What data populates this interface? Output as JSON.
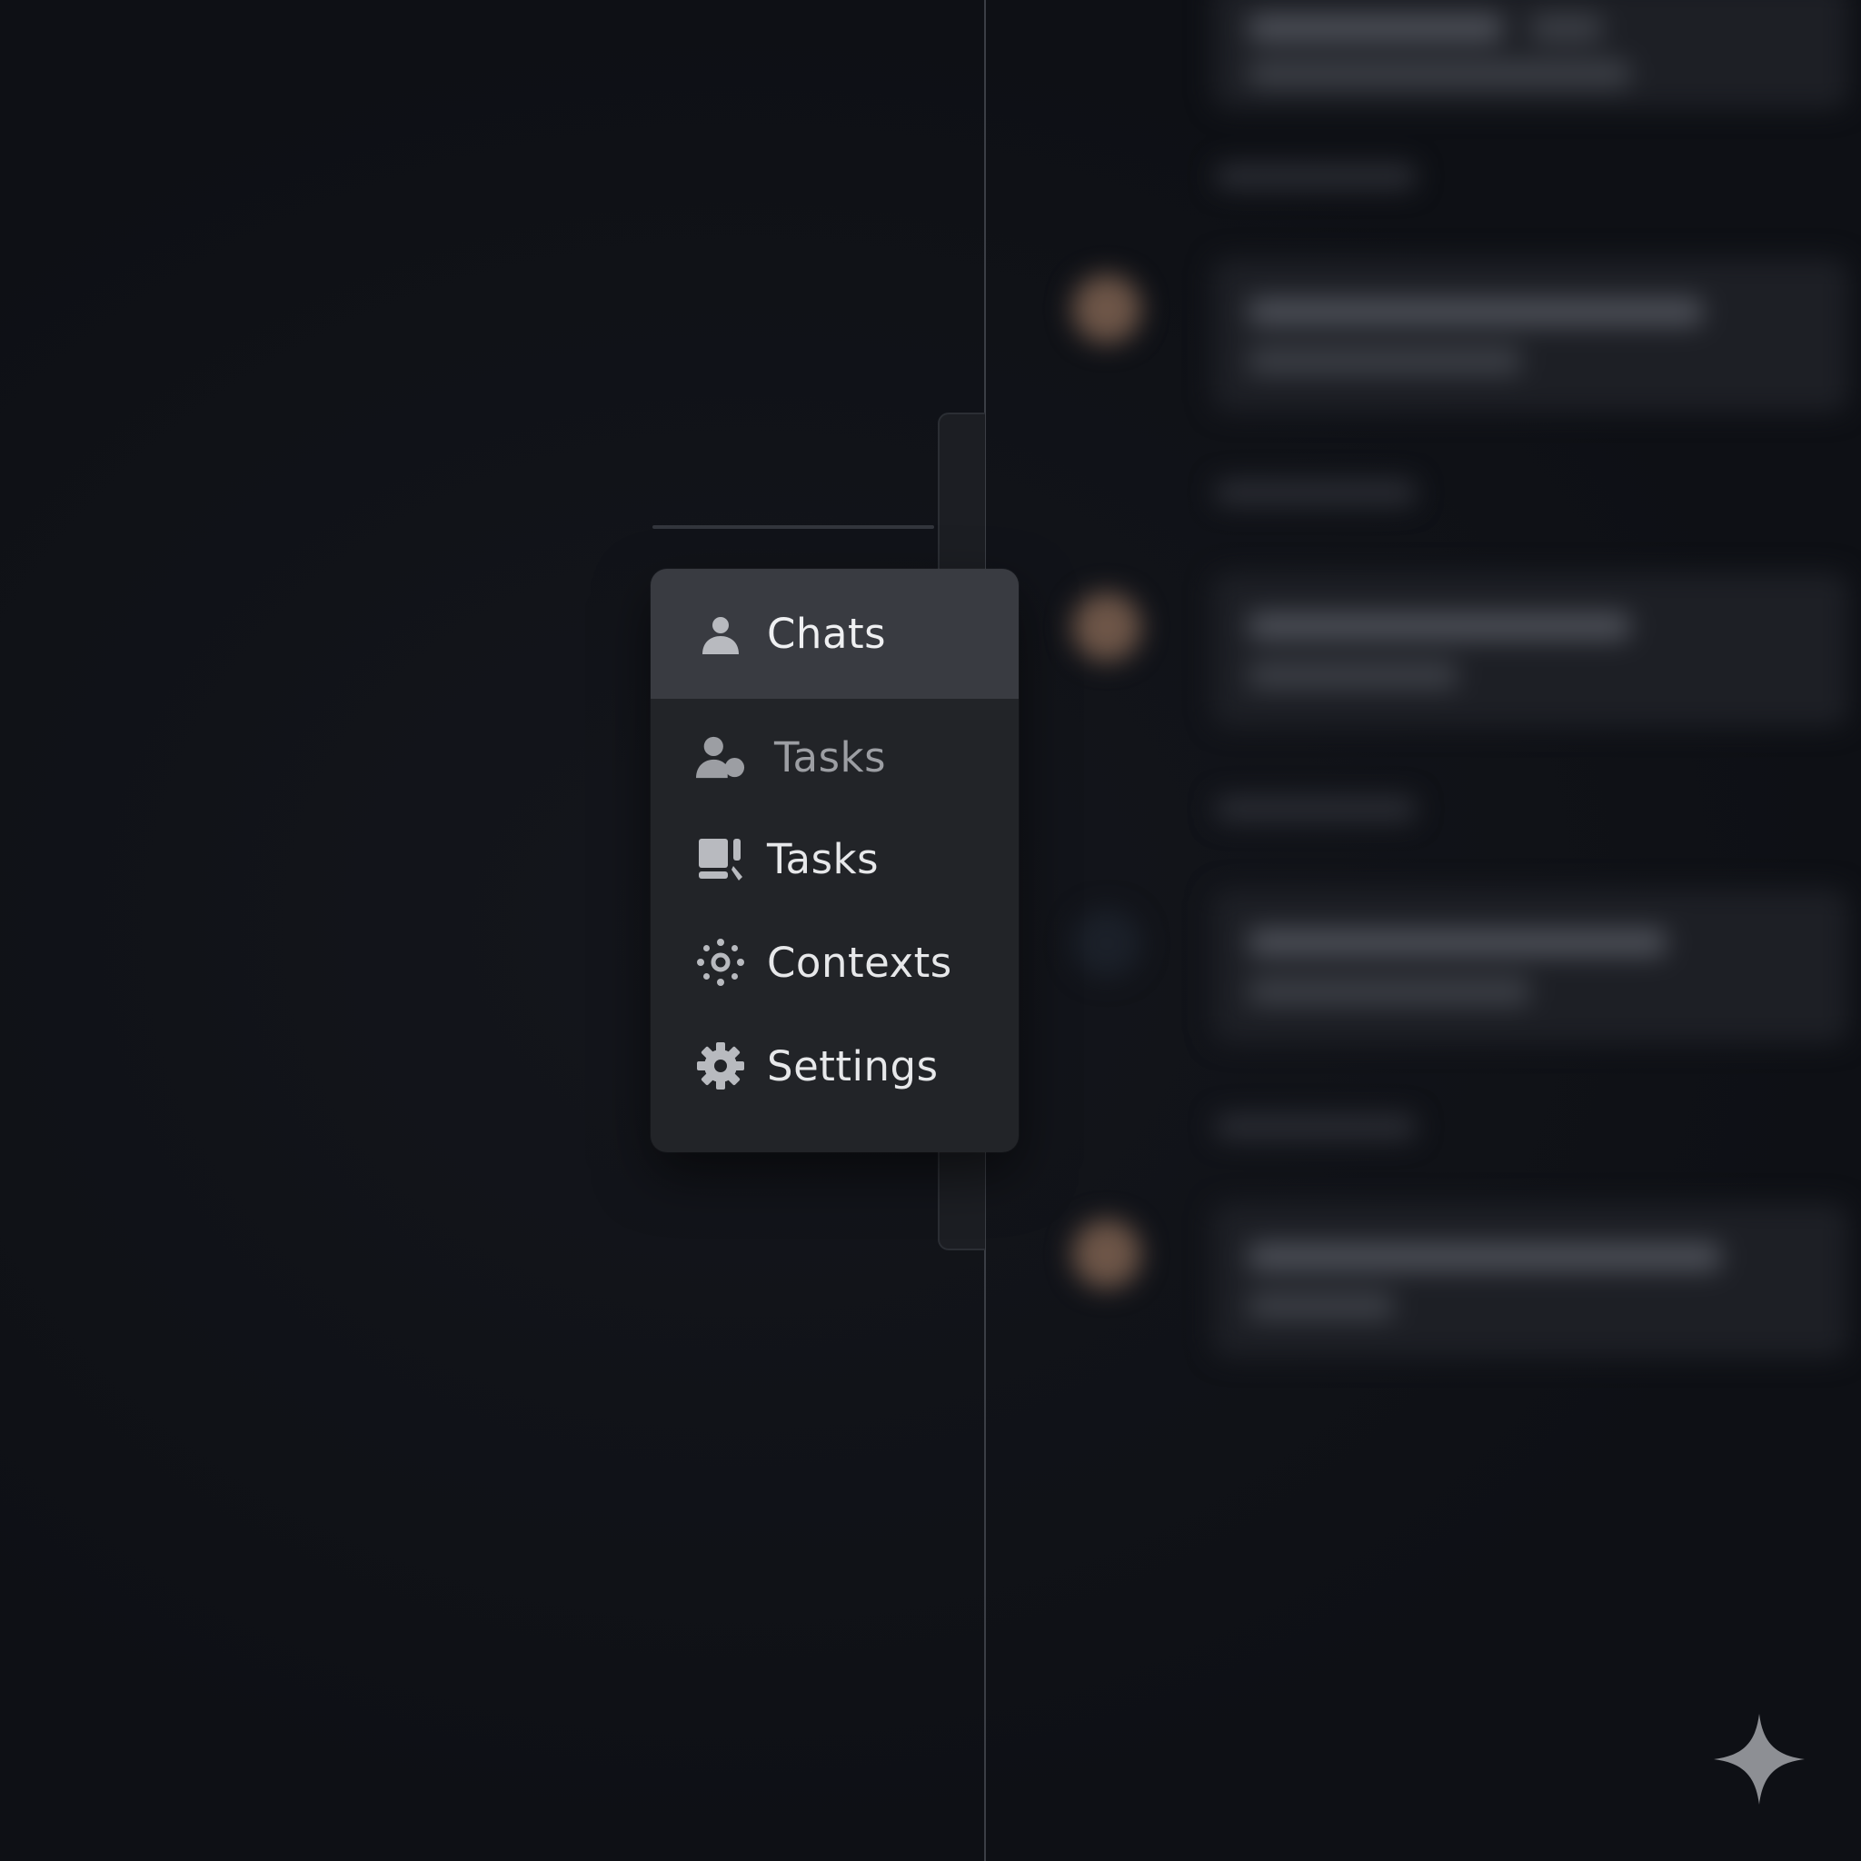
{
  "menu": {
    "items": [
      {
        "label": "Chats",
        "icon": "person-icon",
        "state": "selected"
      },
      {
        "label": "Tasks",
        "icon": "person-group-icon",
        "state": "muted"
      },
      {
        "label": "Tasks",
        "icon": "tasks-board-icon",
        "state": "normal"
      },
      {
        "label": "Contexts",
        "icon": "contexts-icon",
        "state": "normal"
      },
      {
        "label": "Settings",
        "icon": "gear-icon",
        "state": "normal"
      }
    ]
  },
  "colors": {
    "background": "#0f1116",
    "menu_bg": "#222428",
    "selected_bg": "#393b41",
    "text": "#e7e8ea",
    "muted_text": "#9c9ea3",
    "icon": "#b8babf"
  },
  "corner_mark": {
    "icon": "sparkle-icon"
  }
}
